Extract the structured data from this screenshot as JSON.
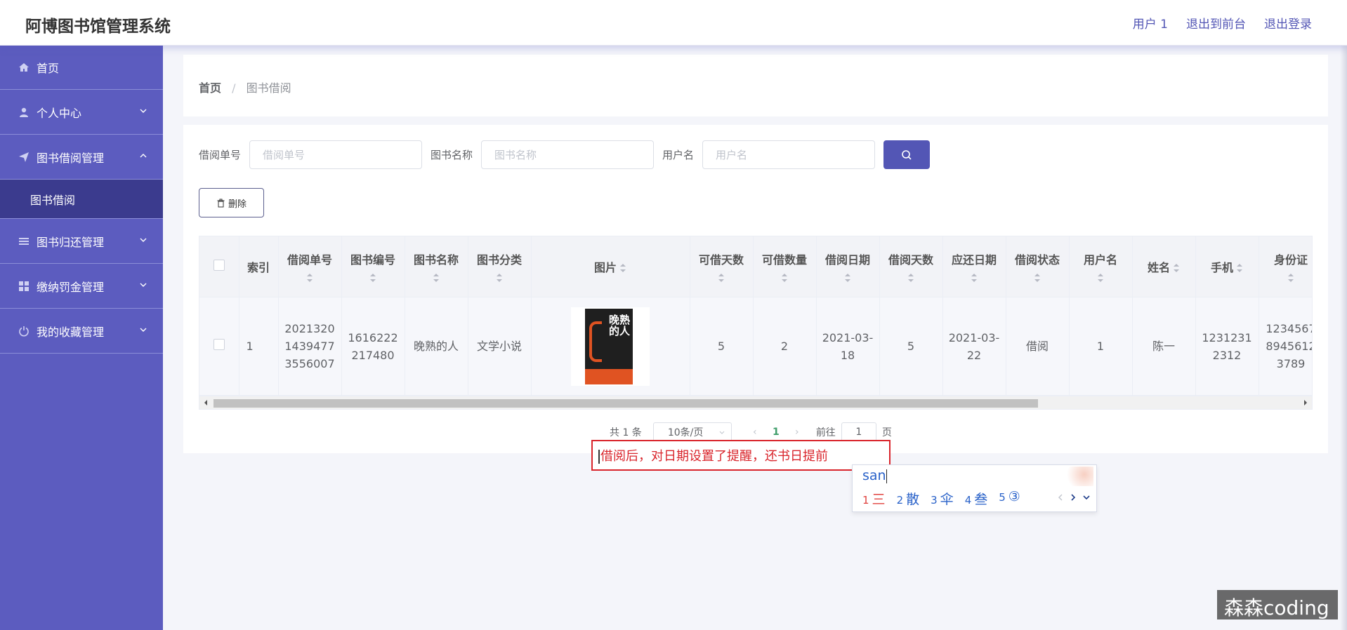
{
  "header": {
    "app_title": "阿博图书馆管理系统",
    "user_label": "用户 1",
    "back_to_front": "退出到前台",
    "logout": "退出登录"
  },
  "sidebar": {
    "items": [
      {
        "label": "首页",
        "icon": "home-icon"
      },
      {
        "label": "个人中心",
        "icon": "user-icon"
      },
      {
        "label": "图书借阅管理",
        "icon": "send-icon"
      },
      {
        "label": "图书借阅",
        "icon": ""
      },
      {
        "label": "图书归还管理",
        "icon": "list-icon"
      },
      {
        "label": "缴纳罚金管理",
        "icon": "grid-icon"
      },
      {
        "label": "我的收藏管理",
        "icon": "power-icon"
      }
    ]
  },
  "breadcrumb": {
    "home": "首页",
    "separator": "/",
    "current": "图书借阅"
  },
  "search": {
    "fields": [
      {
        "label": "借阅单号",
        "placeholder": "借阅单号"
      },
      {
        "label": "图书名称",
        "placeholder": "图书名称"
      },
      {
        "label": "用户名",
        "placeholder": "用户名"
      }
    ],
    "search_icon": "search-icon"
  },
  "toolbar": {
    "delete_label": "删除",
    "delete_icon": "trash-icon"
  },
  "table": {
    "headers": [
      "索引",
      "借阅单号",
      "图书编号",
      "图书名称",
      "图书分类",
      "图片",
      "可借天数",
      "可借数量",
      "借阅日期",
      "借阅天数",
      "应还日期",
      "借阅状态",
      "用户名",
      "姓名",
      "手机",
      "身份证"
    ],
    "rows": [
      {
        "index": "1",
        "borrow_no": "202132014394773556007",
        "book_no": "1616222217480",
        "book_name": "晚熟的人",
        "category": "文学小说",
        "cover_title": "晚熟的人",
        "days_allowed": "5",
        "qty_available": "2",
        "borrow_date": "2021-03-18",
        "borrow_days": "5",
        "due_date": "2021-03-22",
        "status": "借阅",
        "username": "1",
        "name": "陈一",
        "phone": "12312312312",
        "id_card": "12345678945612 3789"
      }
    ]
  },
  "pagination": {
    "total": "共 1 条",
    "page_size": "10条/页",
    "current_page": "1",
    "goto_prefix": "前往",
    "goto_value": "1",
    "goto_suffix": "页"
  },
  "annotation": {
    "text": "借阅后，对日期设置了提醒，还书日提前"
  },
  "ime": {
    "pinyin": "san",
    "candidates": [
      {
        "n": "1",
        "text": "三"
      },
      {
        "n": "2",
        "text": "散"
      },
      {
        "n": "3",
        "text": "伞"
      },
      {
        "n": "4",
        "text": "叁"
      },
      {
        "n": "5",
        "text": "③"
      }
    ]
  },
  "watermark": "森森coding",
  "colors": {
    "sidebar": "#5c5cbf",
    "sidebar_active": "#3b3b8e",
    "accent": "#5356b5",
    "annotation_red": "#d9242b"
  }
}
